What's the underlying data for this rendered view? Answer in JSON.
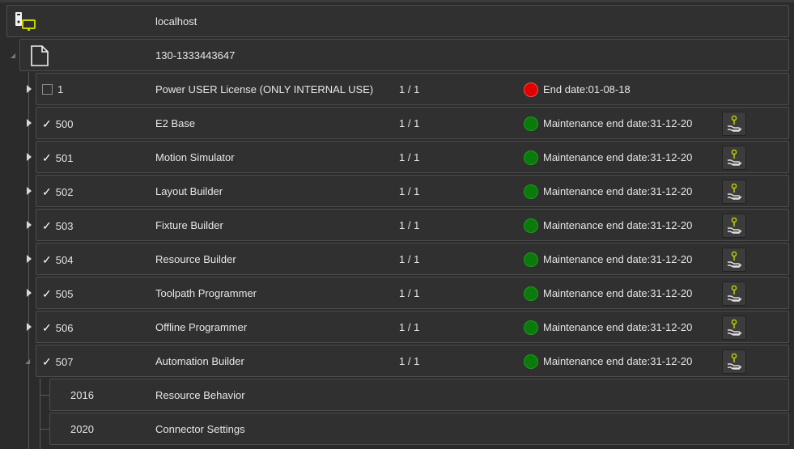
{
  "host": {
    "label": "localhost"
  },
  "license": {
    "id": "130-1333443647"
  },
  "modules": [
    {
      "id": "1",
      "name": "Power USER License (ONLY INTERNAL USE)",
      "count": "1 / 1",
      "status": "End date:01-08-18",
      "status_color": "#e00000",
      "checked": false,
      "has_action": false
    },
    {
      "id": "500",
      "name": "E2 Base",
      "count": "1 / 1",
      "status": "Maintenance end date:31-12-20",
      "status_color": "#0a7a0a",
      "checked": true,
      "has_action": true
    },
    {
      "id": "501",
      "name": "Motion Simulator",
      "count": "1 / 1",
      "status": "Maintenance end date:31-12-20",
      "status_color": "#0a7a0a",
      "checked": true,
      "has_action": true
    },
    {
      "id": "502",
      "name": "Layout Builder",
      "count": "1 / 1",
      "status": "Maintenance end date:31-12-20",
      "status_color": "#0a7a0a",
      "checked": true,
      "has_action": true
    },
    {
      "id": "503",
      "name": "Fixture Builder",
      "count": "1 / 1",
      "status": "Maintenance end date:31-12-20",
      "status_color": "#0a7a0a",
      "checked": true,
      "has_action": true
    },
    {
      "id": "504",
      "name": "Resource Builder",
      "count": "1 / 1",
      "status": "Maintenance end date:31-12-20",
      "status_color": "#0a7a0a",
      "checked": true,
      "has_action": true
    },
    {
      "id": "505",
      "name": "Toolpath Programmer",
      "count": "1 / 1",
      "status": "Maintenance end date:31-12-20",
      "status_color": "#0a7a0a",
      "checked": true,
      "has_action": true
    },
    {
      "id": "506",
      "name": "Offline Programmer",
      "count": "1 / 1",
      "status": "Maintenance end date:31-12-20",
      "status_color": "#0a7a0a",
      "checked": true,
      "has_action": true
    },
    {
      "id": "507",
      "name": "Automation Builder",
      "count": "1 / 1",
      "status": "Maintenance end date:31-12-20",
      "status_color": "#0a7a0a",
      "checked": true,
      "has_action": true
    }
  ],
  "submodules": [
    {
      "id": "2016",
      "name": "Resource Behavior"
    },
    {
      "id": "2020",
      "name": "Connector Settings"
    }
  ],
  "icons": {
    "host": "computer-server-icon",
    "license": "document-icon",
    "expand": "triangle-right-icon",
    "action": "hand-coin-icon"
  }
}
